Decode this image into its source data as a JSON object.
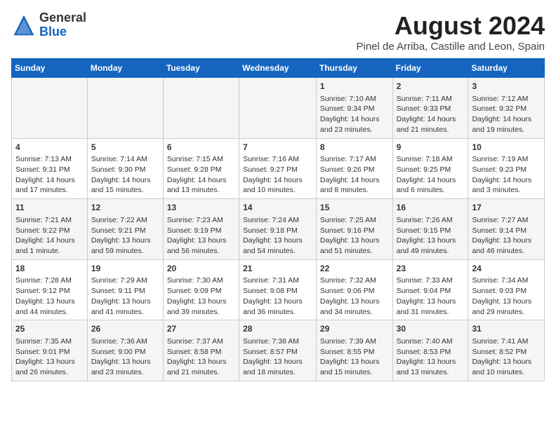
{
  "header": {
    "logo_general": "General",
    "logo_blue": "Blue",
    "month_year": "August 2024",
    "location": "Pinel de Arriba, Castille and Leon, Spain"
  },
  "calendar": {
    "days_of_week": [
      "Sunday",
      "Monday",
      "Tuesday",
      "Wednesday",
      "Thursday",
      "Friday",
      "Saturday"
    ],
    "weeks": [
      [
        {
          "day": "",
          "content": ""
        },
        {
          "day": "",
          "content": ""
        },
        {
          "day": "",
          "content": ""
        },
        {
          "day": "",
          "content": ""
        },
        {
          "day": "1",
          "content": "Sunrise: 7:10 AM\nSunset: 9:34 PM\nDaylight: 14 hours and 23 minutes."
        },
        {
          "day": "2",
          "content": "Sunrise: 7:11 AM\nSunset: 9:33 PM\nDaylight: 14 hours and 21 minutes."
        },
        {
          "day": "3",
          "content": "Sunrise: 7:12 AM\nSunset: 9:32 PM\nDaylight: 14 hours and 19 minutes."
        }
      ],
      [
        {
          "day": "4",
          "content": "Sunrise: 7:13 AM\nSunset: 9:31 PM\nDaylight: 14 hours and 17 minutes."
        },
        {
          "day": "5",
          "content": "Sunrise: 7:14 AM\nSunset: 9:30 PM\nDaylight: 14 hours and 15 minutes."
        },
        {
          "day": "6",
          "content": "Sunrise: 7:15 AM\nSunset: 9:28 PM\nDaylight: 14 hours and 13 minutes."
        },
        {
          "day": "7",
          "content": "Sunrise: 7:16 AM\nSunset: 9:27 PM\nDaylight: 14 hours and 10 minutes."
        },
        {
          "day": "8",
          "content": "Sunrise: 7:17 AM\nSunset: 9:26 PM\nDaylight: 14 hours and 8 minutes."
        },
        {
          "day": "9",
          "content": "Sunrise: 7:18 AM\nSunset: 9:25 PM\nDaylight: 14 hours and 6 minutes."
        },
        {
          "day": "10",
          "content": "Sunrise: 7:19 AM\nSunset: 9:23 PM\nDaylight: 14 hours and 3 minutes."
        }
      ],
      [
        {
          "day": "11",
          "content": "Sunrise: 7:21 AM\nSunset: 9:22 PM\nDaylight: 14 hours and 1 minute."
        },
        {
          "day": "12",
          "content": "Sunrise: 7:22 AM\nSunset: 9:21 PM\nDaylight: 13 hours and 59 minutes."
        },
        {
          "day": "13",
          "content": "Sunrise: 7:23 AM\nSunset: 9:19 PM\nDaylight: 13 hours and 56 minutes."
        },
        {
          "day": "14",
          "content": "Sunrise: 7:24 AM\nSunset: 9:18 PM\nDaylight: 13 hours and 54 minutes."
        },
        {
          "day": "15",
          "content": "Sunrise: 7:25 AM\nSunset: 9:16 PM\nDaylight: 13 hours and 51 minutes."
        },
        {
          "day": "16",
          "content": "Sunrise: 7:26 AM\nSunset: 9:15 PM\nDaylight: 13 hours and 49 minutes."
        },
        {
          "day": "17",
          "content": "Sunrise: 7:27 AM\nSunset: 9:14 PM\nDaylight: 13 hours and 46 minutes."
        }
      ],
      [
        {
          "day": "18",
          "content": "Sunrise: 7:28 AM\nSunset: 9:12 PM\nDaylight: 13 hours and 44 minutes."
        },
        {
          "day": "19",
          "content": "Sunrise: 7:29 AM\nSunset: 9:11 PM\nDaylight: 13 hours and 41 minutes."
        },
        {
          "day": "20",
          "content": "Sunrise: 7:30 AM\nSunset: 9:09 PM\nDaylight: 13 hours and 39 minutes."
        },
        {
          "day": "21",
          "content": "Sunrise: 7:31 AM\nSunset: 9:08 PM\nDaylight: 13 hours and 36 minutes."
        },
        {
          "day": "22",
          "content": "Sunrise: 7:32 AM\nSunset: 9:06 PM\nDaylight: 13 hours and 34 minutes."
        },
        {
          "day": "23",
          "content": "Sunrise: 7:33 AM\nSunset: 9:04 PM\nDaylight: 13 hours and 31 minutes."
        },
        {
          "day": "24",
          "content": "Sunrise: 7:34 AM\nSunset: 9:03 PM\nDaylight: 13 hours and 29 minutes."
        }
      ],
      [
        {
          "day": "25",
          "content": "Sunrise: 7:35 AM\nSunset: 9:01 PM\nDaylight: 13 hours and 26 minutes."
        },
        {
          "day": "26",
          "content": "Sunrise: 7:36 AM\nSunset: 9:00 PM\nDaylight: 13 hours and 23 minutes."
        },
        {
          "day": "27",
          "content": "Sunrise: 7:37 AM\nSunset: 8:58 PM\nDaylight: 13 hours and 21 minutes."
        },
        {
          "day": "28",
          "content": "Sunrise: 7:38 AM\nSunset: 8:57 PM\nDaylight: 13 hours and 18 minutes."
        },
        {
          "day": "29",
          "content": "Sunrise: 7:39 AM\nSunset: 8:55 PM\nDaylight: 13 hours and 15 minutes."
        },
        {
          "day": "30",
          "content": "Sunrise: 7:40 AM\nSunset: 8:53 PM\nDaylight: 13 hours and 13 minutes."
        },
        {
          "day": "31",
          "content": "Sunrise: 7:41 AM\nSunset: 8:52 PM\nDaylight: 13 hours and 10 minutes."
        }
      ]
    ]
  }
}
